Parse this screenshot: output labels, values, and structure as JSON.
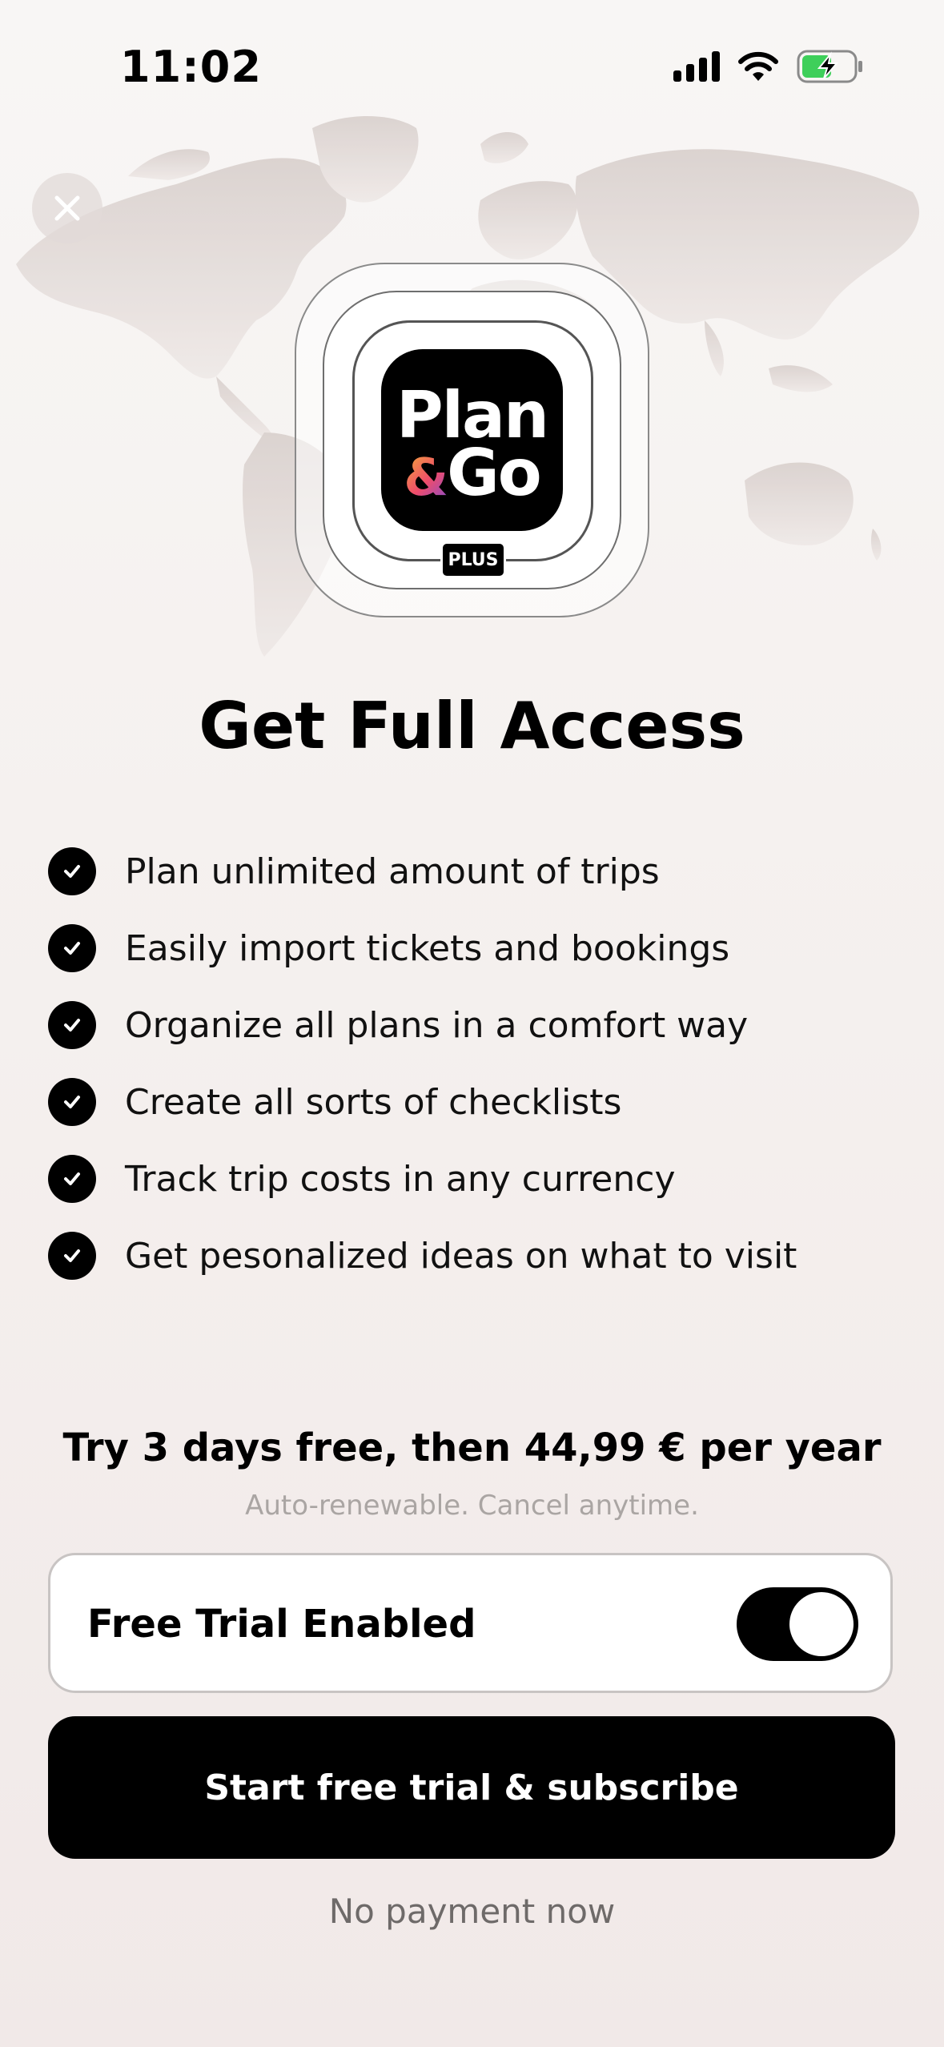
{
  "status_bar": {
    "time": "11:02",
    "icons": [
      "signal-icon",
      "wifi-icon",
      "battery-charging-icon"
    ]
  },
  "close_icon": "close-icon",
  "logo": {
    "line1": "Plan",
    "ampersand": "&",
    "line2": "Go",
    "badge": "PLUS"
  },
  "headline": "Get Full Access",
  "features": [
    {
      "text": "Plan unlimited amount of trips"
    },
    {
      "text": "Easily import tickets and bookings"
    },
    {
      "text": "Organize all plans in a comfort way"
    },
    {
      "text": "Create all sorts of checklists"
    },
    {
      "text": "Track trip costs in any currency"
    },
    {
      "text": "Get pesonalized ideas on what to visit"
    }
  ],
  "pricing": {
    "offer": "Try 3 days free, then 44,99 € per year",
    "note": "Auto-renewable. Cancel anytime."
  },
  "trial_toggle": {
    "label": "Free Trial Enabled",
    "enabled": true
  },
  "cta": {
    "label": "Start free trial & subscribe"
  },
  "footnote": "No payment now",
  "colors": {
    "accent": "#000000",
    "background": "#f5f1ef",
    "muted": "#aaa5a3",
    "battery_green": "#3ecf5a"
  }
}
